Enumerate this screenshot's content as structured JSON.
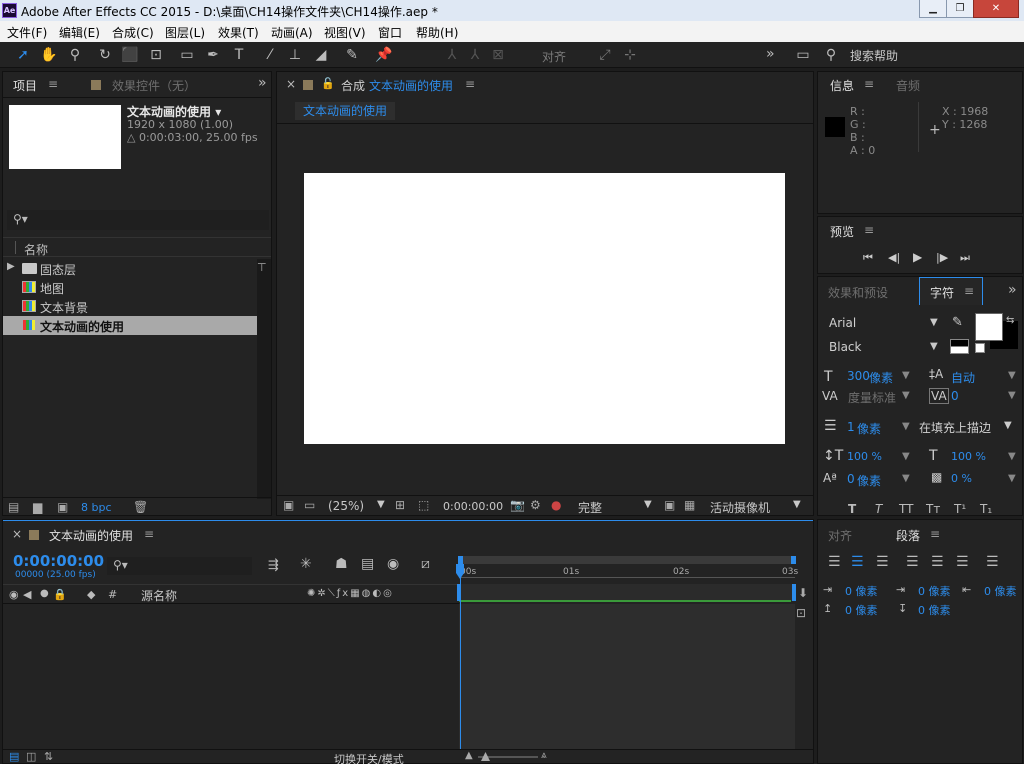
{
  "window": {
    "title": "Adobe After Effects CC 2015 - D:\\桌面\\CH14操作文件夹\\CH14操作.aep *",
    "app_icon": "Ae",
    "minimize": "▁",
    "restore": "❐",
    "close": "✕"
  },
  "menu": [
    "文件(F)",
    "编辑(E)",
    "合成(C)",
    "图层(L)",
    "效果(T)",
    "动画(A)",
    "视图(V)",
    "窗口",
    "帮助(H)"
  ],
  "toolbar": {
    "align_label": "对齐",
    "more": "»",
    "search_help": "搜索帮助"
  },
  "project_panel": {
    "tab_project": "项目",
    "tab_effects": "效果控件（无）",
    "more": "»",
    "comp_name": "文本动画的使用",
    "dropdown_arrow": "▾",
    "comp_size": "1920 x 1080 (1.00)",
    "comp_duration": "△ 0:00:03:00, 25.00 fps",
    "search_placeholder": "",
    "column_name": "名称",
    "items": [
      {
        "label": "固态层",
        "type": "folder"
      },
      {
        "label": "地图",
        "type": "comp"
      },
      {
        "label": "文本背景",
        "type": "comp"
      },
      {
        "label": "文本动画的使用",
        "type": "comp",
        "selected": true
      }
    ],
    "bpc": "8 bpc"
  },
  "composition_panel": {
    "close": "×",
    "tab_prefix": "合成",
    "tab_name": "文本动画的使用",
    "flowchart_label": "文本动画的使用",
    "zoom": "(25%)",
    "timecode": "0:00:00:00",
    "resolution": "完整",
    "camera": "活动摄像机"
  },
  "info_panel": {
    "tab_info": "信息",
    "tab_audio": "音频",
    "r": "R :",
    "g": "G :",
    "b": "B :",
    "a": "A : 0",
    "x": "X : 1968",
    "y": "Y : 1268"
  },
  "preview_panel": {
    "title": "预览",
    "controls": [
      "⏮",
      "◀|",
      "▶",
      "|▶",
      "⏭"
    ]
  },
  "character_panel": {
    "tab_effects_presets": "效果和预设",
    "tab_character": "字符",
    "more": "»",
    "font": "Arial",
    "style": "Black",
    "size_value": "300",
    "size_unit": "像素",
    "leading": "自动",
    "kerning": "度量标准",
    "tracking": "0",
    "stroke_width_value": "1",
    "stroke_width_unit": "像素",
    "stroke_mode": "在填充上描边",
    "vscale": "100 %",
    "hscale": "100 %",
    "baseline_value": "0",
    "baseline_unit": "像素",
    "tsume": "0 %",
    "styles": [
      "T",
      "T",
      "TT",
      "Tт",
      "T¹",
      "T₁"
    ]
  },
  "paragraph_panel": {
    "tab_align": "对齐",
    "tab_paragraph": "段落",
    "indent_left": "0 像素",
    "indent_first": "0 像素",
    "indent_right": "0 像素",
    "space_before": "0 像素",
    "space_after": "0 像素"
  },
  "timeline_panel": {
    "close": "×",
    "tab_name": "文本动画的使用",
    "timecode": "0:00:00:00",
    "frames": "00000 (25.00 fps)",
    "col_source": "源名称",
    "col_hash": "#",
    "ticks": [
      "00s",
      "01s",
      "02s",
      "03s"
    ],
    "toggle_label": "切换开关/模式"
  },
  "colors": {
    "accent_blue": "#2d8ceb",
    "panel_bg": "#232323",
    "app_bg": "#1d1d1d",
    "timeline_green": "#3a9a3a"
  }
}
